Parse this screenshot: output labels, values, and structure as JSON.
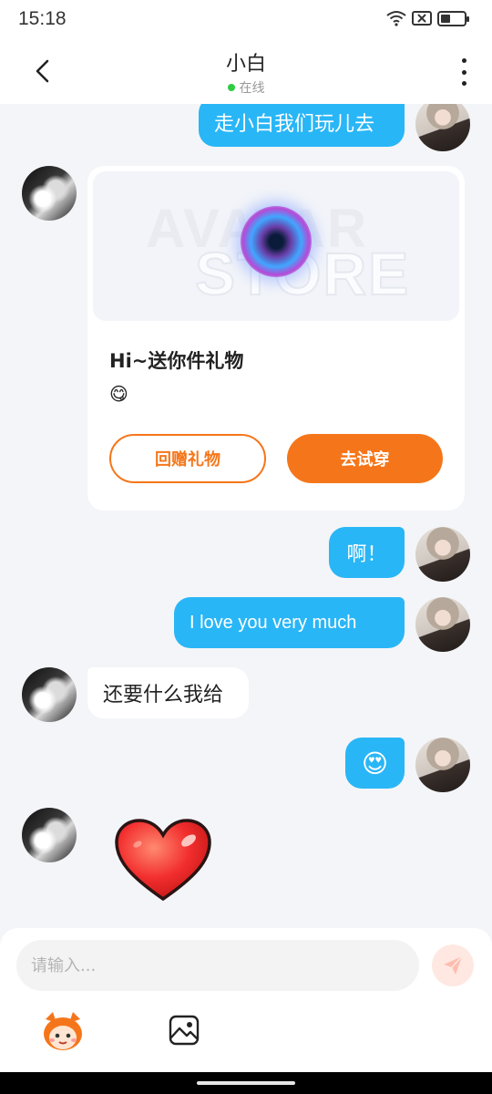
{
  "status_bar": {
    "time": "15:18"
  },
  "header": {
    "title": "小白",
    "presence": "在线"
  },
  "messages": {
    "m1": "走小白我们玩儿去",
    "m3": "啊！",
    "m4": "I love you very much",
    "m5": "还要什么我给",
    "m6": "😍"
  },
  "gift_card": {
    "watermark_top": "AVATAR",
    "watermark_bottom": "STORE",
    "greeting": "Hi~送你件礼物",
    "emoji": "😋",
    "return_gift_label": "回赠礼物",
    "try_on_label": "去试穿"
  },
  "composer": {
    "placeholder": "请输入..."
  },
  "colors": {
    "outgoing_bubble": "#29b6f6",
    "accent": "#f5761a",
    "presence_dot": "#2ecc40"
  }
}
